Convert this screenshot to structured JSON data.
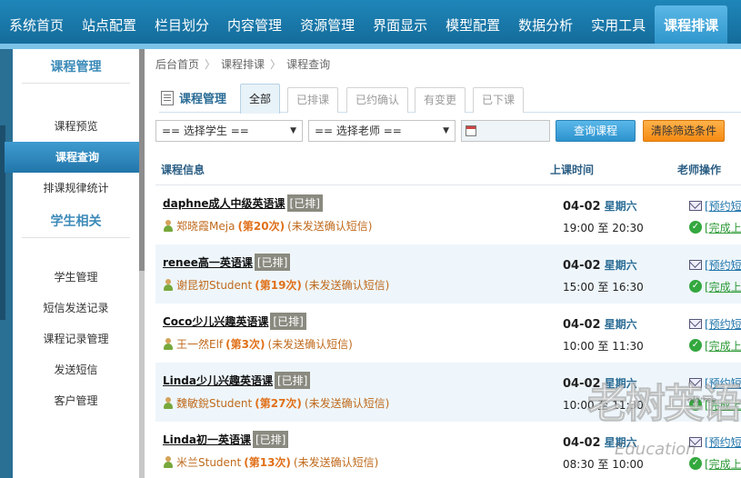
{
  "topnav": {
    "items": [
      "系统首页",
      "站点配置",
      "栏目划分",
      "内容管理",
      "资源管理",
      "界面显示",
      "模型配置",
      "数据分析",
      "实用工具",
      "课程排课"
    ],
    "active": "课程排课"
  },
  "sidebar": {
    "group1_title": "课程管理",
    "group1_items": [
      "课程预览",
      "课程查询",
      "排课规律统计"
    ],
    "active_item": "课程查询",
    "group2_title": "学生相关",
    "group2_items": [
      "学生管理",
      "短信发送记录",
      "课程记录管理",
      "发送短信",
      "客户管理"
    ]
  },
  "breadcrumb": [
    "后台首页",
    "课程排课",
    "课程查询"
  ],
  "tabs": {
    "label": "课程管理",
    "items": [
      "全部",
      "已排课",
      "已约确认",
      "有变更",
      "已下课"
    ],
    "active": "全部"
  },
  "filters": {
    "student_select": "== 选择学生 ==",
    "teacher_select": "== 选择老师 ==",
    "query_button": "查询课程",
    "clear_button": "清除筛选条件"
  },
  "table": {
    "headers": [
      "课程信息",
      "上课时间",
      "老师操作"
    ],
    "rows": [
      {
        "course": "daphne成人中级英语课",
        "status": "[已排]",
        "student": "郑晓霞Meja",
        "count": "(第20次)",
        "sms": "(未发送确认短信)",
        "date": "04-02",
        "weekday": "星期六",
        "time": "19:00 至 20:30",
        "op1": "[预约短信]",
        "op2": "[完成上课]"
      },
      {
        "course": "renee高一英语课",
        "status": "[已排]",
        "student": "谢昆初Student",
        "count": "(第19次)",
        "sms": "(未发送确认短信)",
        "date": "04-02",
        "weekday": "星期六",
        "time": "15:00 至 16:30",
        "op1": "[预约短信]",
        "op2": "[完成上课]"
      },
      {
        "course": "Coco少儿兴趣英语课",
        "status": "[已排]",
        "student": "王一然Elf",
        "count": "(第3次)",
        "sms": "(未发送确认短信)",
        "date": "04-02",
        "weekday": "星期六",
        "time": "10:00 至 11:30",
        "op1": "[预约短信]",
        "op2": "[完成上课]"
      },
      {
        "course": "Linda少儿兴趣英语课",
        "status": "[已排]",
        "student": "魏敏銳Student",
        "count": "(第27次)",
        "sms": "(未发送确认短信)",
        "date": "04-02",
        "weekday": "星期六",
        "time": "10:00 至 11:30",
        "op1": "[预约短信]",
        "op2": "[完成上课]"
      },
      {
        "course": "Linda初一英语课",
        "status": "[已排]",
        "student": "米兰Student",
        "count": "(第13次)",
        "sms": "(未发送确认短信)",
        "date": "04-02",
        "weekday": "星期六",
        "time": "08:30 至 10:00",
        "op1": "[预约短信]",
        "op2": "[完成上课]"
      }
    ]
  },
  "watermark": {
    "main": "老树英语",
    "sub": "Education",
    "url": "oldtree"
  }
}
